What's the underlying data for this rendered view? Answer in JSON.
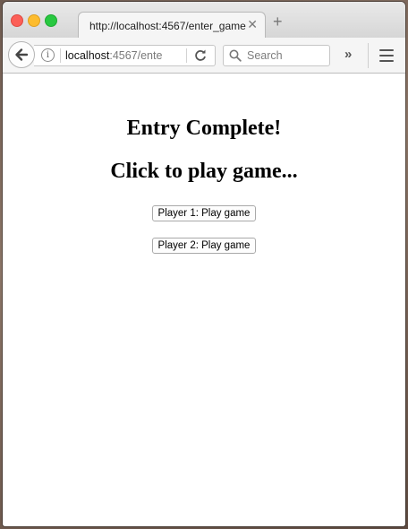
{
  "browser": {
    "tab_title": "http://localhost:4567/enter_game",
    "tab_close": "✕",
    "new_tab": "+",
    "url_host": "localhost",
    "url_rest": ":4567/ente",
    "search_placeholder": "Search",
    "overflow": "»"
  },
  "page": {
    "heading_1": "Entry Complete!",
    "heading_2": "Click to play game...",
    "buttons": [
      {
        "label": "Player 1: Play game"
      },
      {
        "label": "Player 2: Play game"
      }
    ]
  },
  "icons": {
    "back": "back-arrow-icon",
    "info": "info-icon",
    "reload": "reload-icon",
    "search": "search-icon",
    "menu": "hamburger-menu-icon"
  },
  "colors": {
    "close": "#fc5f57",
    "minimize": "#fdbc2e",
    "maximize": "#28c840"
  }
}
